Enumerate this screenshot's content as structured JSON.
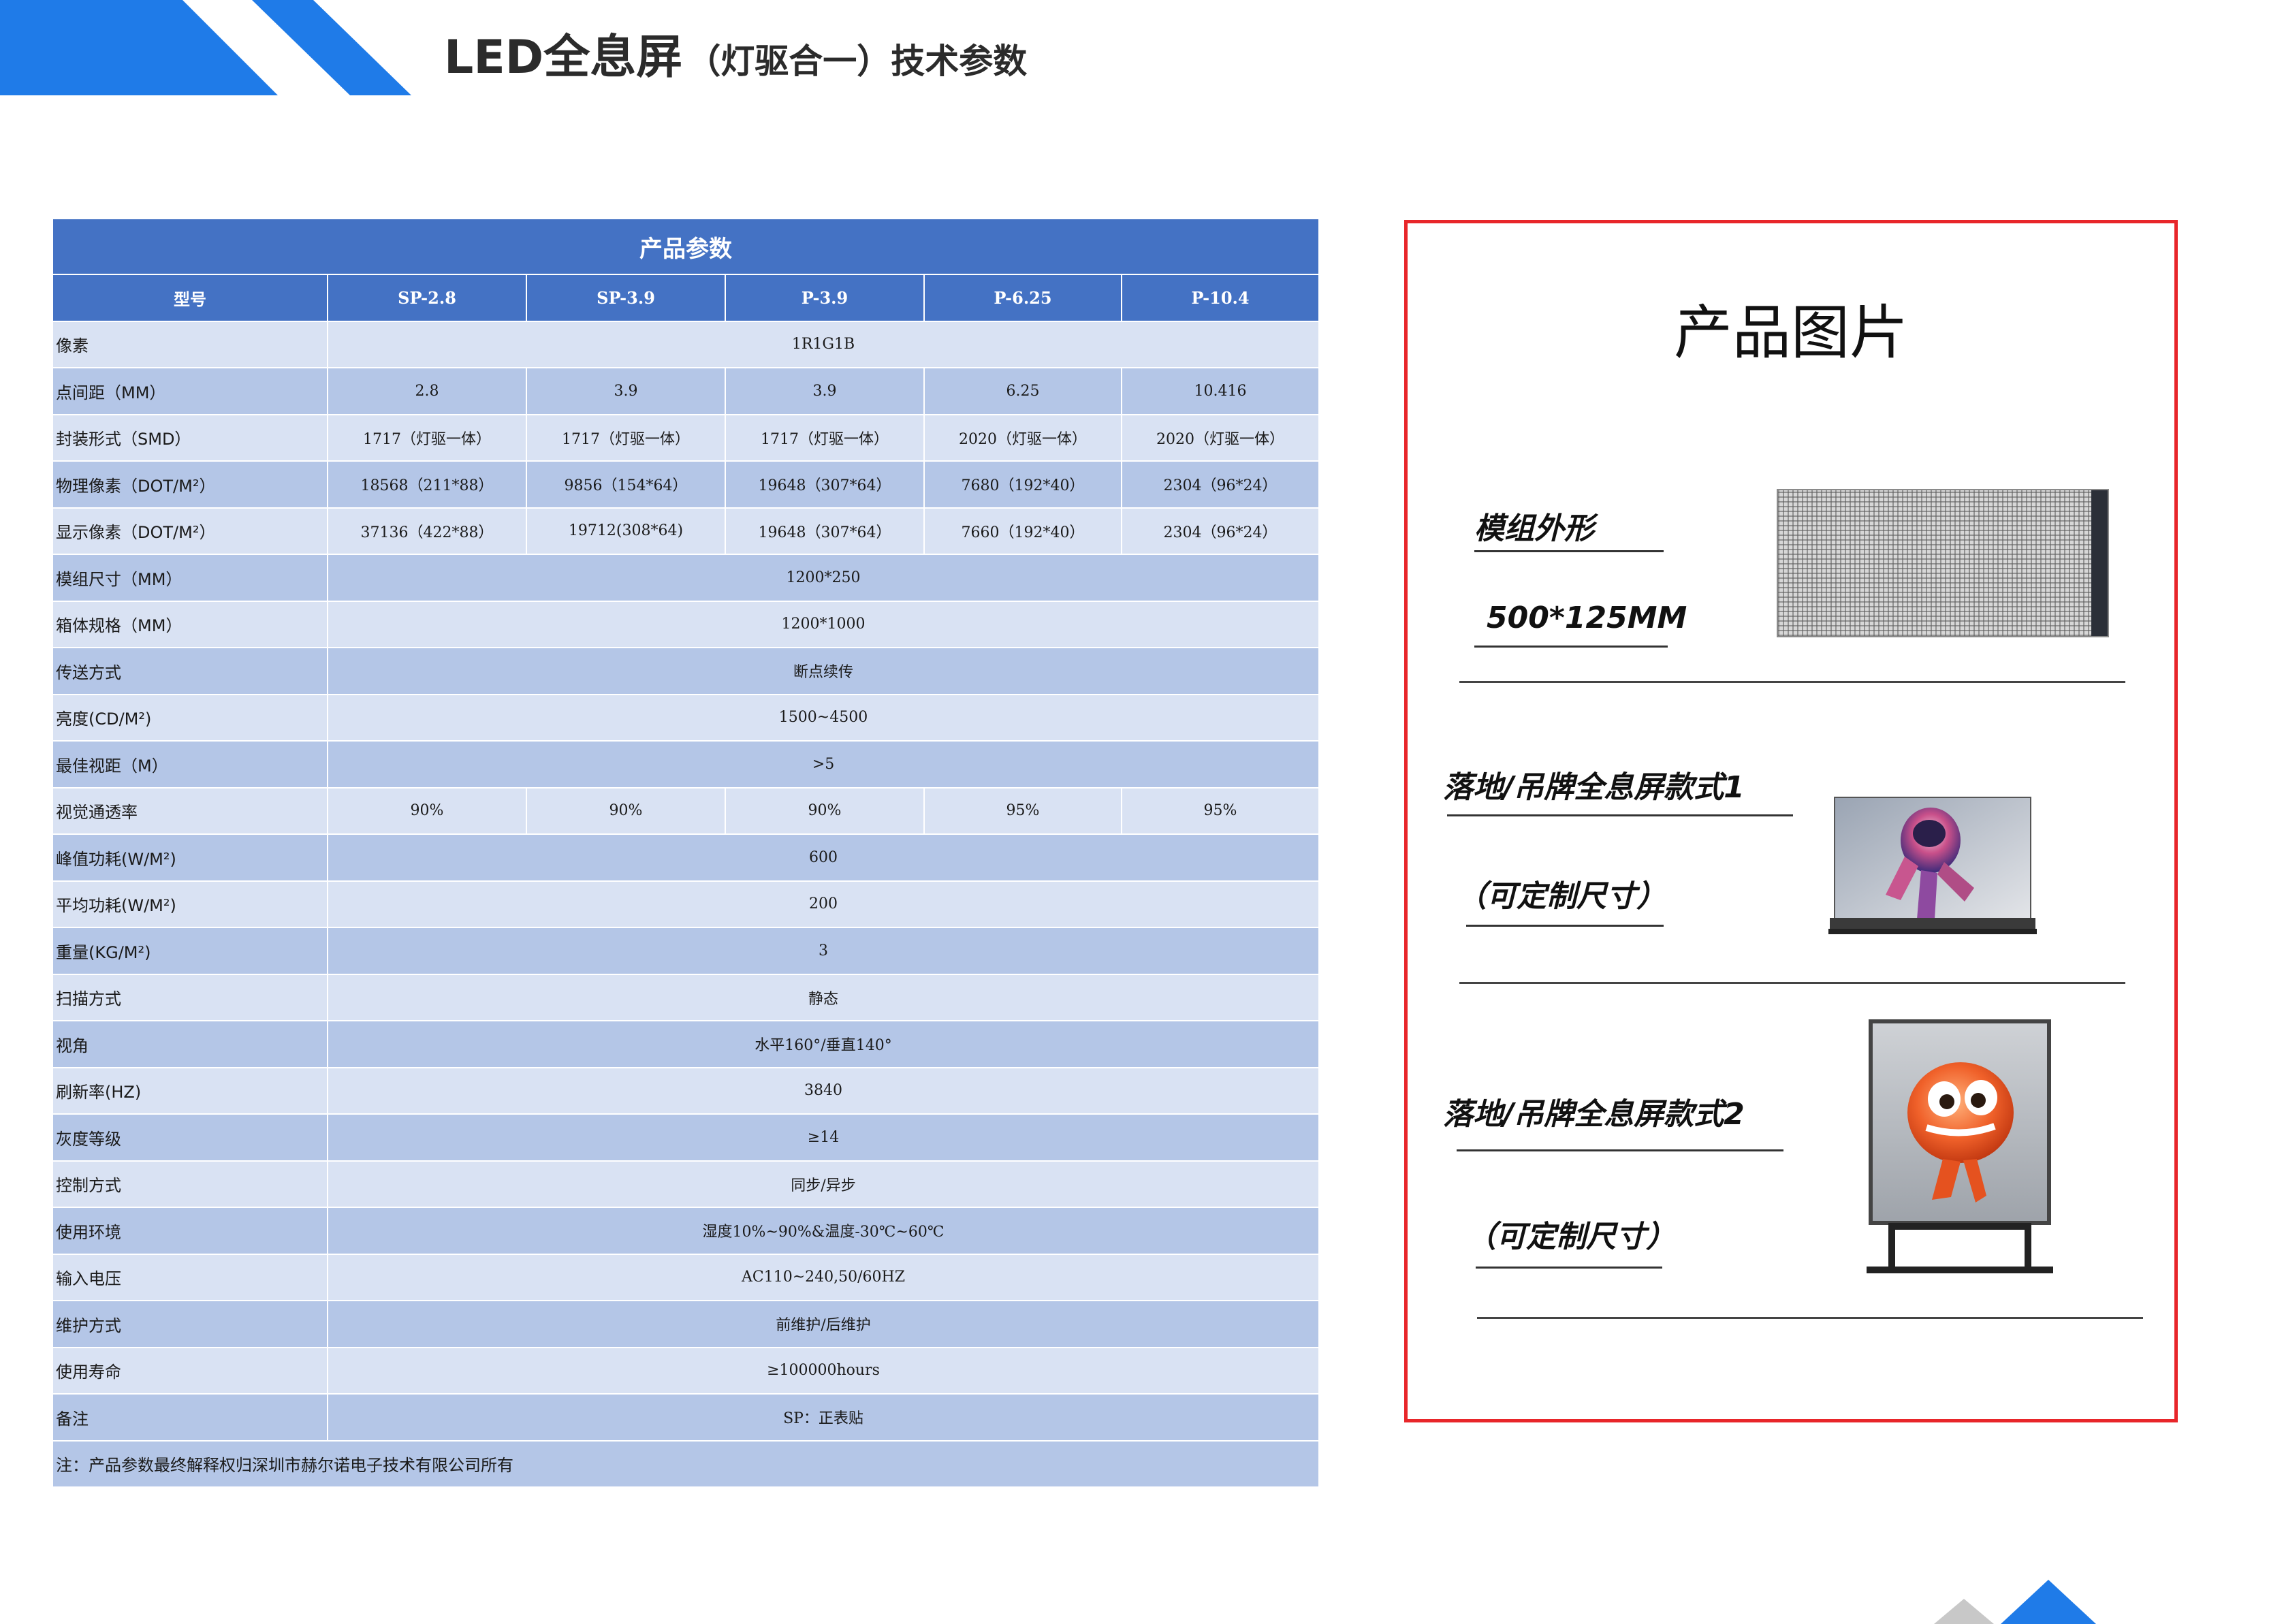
{
  "header": {
    "title_main": "LED全息屏",
    "title_sub": "（灯驱合一）技术参数",
    "stripe_color": "#1f7be8"
  },
  "table": {
    "caption": "产品参数",
    "header_label": "型号",
    "models": [
      "SP-2.8",
      "SP-3.9",
      "P-3.9",
      "P-6.25",
      "P-10.4"
    ],
    "rows": [
      {
        "label": "像素",
        "merged": "1R1G1B"
      },
      {
        "label": "点间距（MM）",
        "cells": [
          "2.8",
          "3.9",
          "3.9",
          "6.25",
          "10.416"
        ]
      },
      {
        "label": "封装形式（SMD）",
        "cells": [
          "1717（灯驱一体）",
          "1717（灯驱一体）",
          "1717（灯驱一体）",
          "2020（灯驱一体）",
          "2020（灯驱一体）"
        ]
      },
      {
        "label": "物理像素（DOT/M²）",
        "cells": [
          "18568（211*88）",
          "9856（154*64）",
          "19648（307*64）",
          "7680（192*40）",
          "2304（96*24）"
        ]
      },
      {
        "label": "显示像素（DOT/M²）",
        "cells": [
          "37136（422*88）",
          "19712(308*64)",
          "19648（307*64）",
          "7660（192*40）",
          "2304（96*24）"
        ]
      },
      {
        "label": "模组尺寸（MM）",
        "merged": "1200*250"
      },
      {
        "label": "箱体规格（MM）",
        "merged": "1200*1000"
      },
      {
        "label": "传送方式",
        "merged": "断点续传"
      },
      {
        "label": "亮度(CD/M²)",
        "merged": "1500~4500"
      },
      {
        "label": "最佳视距（M）",
        "merged": ">5"
      },
      {
        "label": "视觉通透率",
        "cells": [
          "90%",
          "90%",
          "90%",
          "95%",
          "95%"
        ]
      },
      {
        "label": "峰值功耗(W/M²)",
        "merged": "600"
      },
      {
        "label": "平均功耗(W/M²)",
        "merged": "200"
      },
      {
        "label": "重量(KG/M²)",
        "merged": "3"
      },
      {
        "label": "扫描方式",
        "merged": "静态"
      },
      {
        "label": "视角",
        "merged": "水平160°/垂直140°"
      },
      {
        "label": "刷新率(HZ)",
        "merged": "3840"
      },
      {
        "label": "灰度等级",
        "merged": "≥14"
      },
      {
        "label": "控制方式",
        "merged": "同步/异步"
      },
      {
        "label": "使用环境",
        "merged": "湿度10%~90%&温度-30℃~60℃"
      },
      {
        "label": "输入电压",
        "merged": "AC110~240,50/60HZ"
      },
      {
        "label": "维护方式",
        "merged": "前维护/后维护"
      },
      {
        "label": "使用寿命",
        "merged": "≥100000hours"
      },
      {
        "label": "备注",
        "merged": "SP：正表贴"
      }
    ],
    "note": "注：产品参数最终解释权归深圳市赫尔诺电子技术有限公司所有",
    "colors": {
      "header": "#4472c4",
      "row_dark": "#b4c6e7",
      "row_light": "#d9e2f3"
    }
  },
  "panel": {
    "title": "产品图片",
    "module_label": "模组外形",
    "module_size": "500*125MM",
    "style1_label": "落地/吊牌全息屏款式1",
    "style1_custom": "（可定制尺寸）",
    "style2_label": "落地/吊牌全息屏款式2",
    "style2_custom": "（可定制尺寸）",
    "border_color": "#e8262a"
  }
}
